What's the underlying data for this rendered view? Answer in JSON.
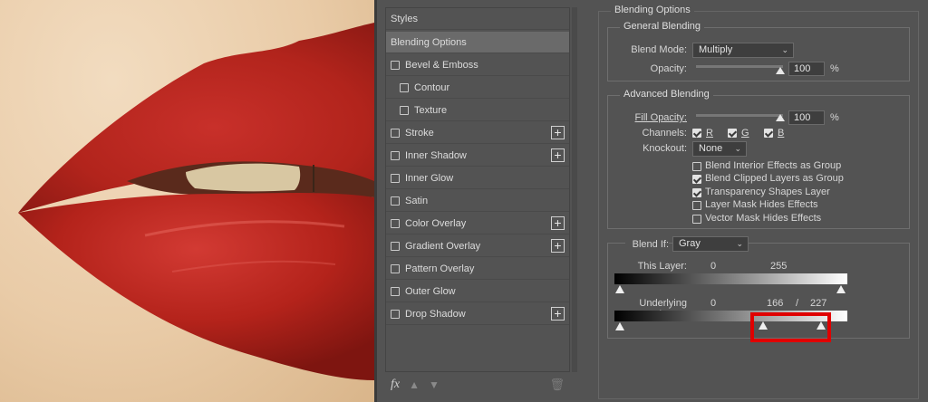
{
  "styles_panel": {
    "items": [
      {
        "label": "Styles",
        "type": "header"
      },
      {
        "label": "Blending Options",
        "type": "active"
      },
      {
        "label": "Bevel & Emboss",
        "checkbox": true
      },
      {
        "label": "Contour",
        "checkbox": true,
        "sub": true
      },
      {
        "label": "Texture",
        "checkbox": true,
        "sub": true
      },
      {
        "label": "Stroke",
        "checkbox": true,
        "plus": true
      },
      {
        "label": "Inner Shadow",
        "checkbox": true,
        "plus": true
      },
      {
        "label": "Inner Glow",
        "checkbox": true
      },
      {
        "label": "Satin",
        "checkbox": true
      },
      {
        "label": "Color Overlay",
        "checkbox": true,
        "plus": true
      },
      {
        "label": "Gradient Overlay",
        "checkbox": true,
        "plus": true
      },
      {
        "label": "Pattern Overlay",
        "checkbox": true
      },
      {
        "label": "Outer Glow",
        "checkbox": true
      },
      {
        "label": "Drop Shadow",
        "checkbox": true,
        "plus": true
      }
    ],
    "fx_label": "fx"
  },
  "blending": {
    "title": "Blending Options",
    "general": {
      "legend": "General Blending",
      "blend_mode_label": "Blend Mode:",
      "blend_mode_value": "Multiply",
      "opacity_label": "Opacity:",
      "opacity_value": "100",
      "unit": "%"
    },
    "advanced": {
      "legend": "Advanced Blending",
      "fill_label": "Fill Opacity:",
      "fill_value": "100",
      "unit": "%",
      "channels_label": "Channels:",
      "channel_r": "R",
      "channel_g": "G",
      "channel_b": "B",
      "knockout_label": "Knockout:",
      "knockout_value": "None",
      "options": [
        {
          "label": "Blend Interior Effects as Group",
          "checked": false
        },
        {
          "label": "Blend Clipped Layers as Group",
          "checked": true
        },
        {
          "label": "Transparency Shapes Layer",
          "checked": true
        },
        {
          "label": "Layer Mask Hides Effects",
          "checked": false
        },
        {
          "label": "Vector Mask Hides Effects",
          "checked": false
        }
      ]
    },
    "blend_if": {
      "label": "Blend If:",
      "value": "Gray",
      "this_layer_label": "This Layer:",
      "this_layer_low": "0",
      "this_layer_high": "255",
      "underlying_label": "Underlying Layer:",
      "underlying_low": "0",
      "underlying_split_a": "166",
      "underlying_sep": "/",
      "underlying_split_b": "227"
    }
  },
  "colors": {
    "highlight": "#e00000",
    "lip": "#b2241c"
  }
}
